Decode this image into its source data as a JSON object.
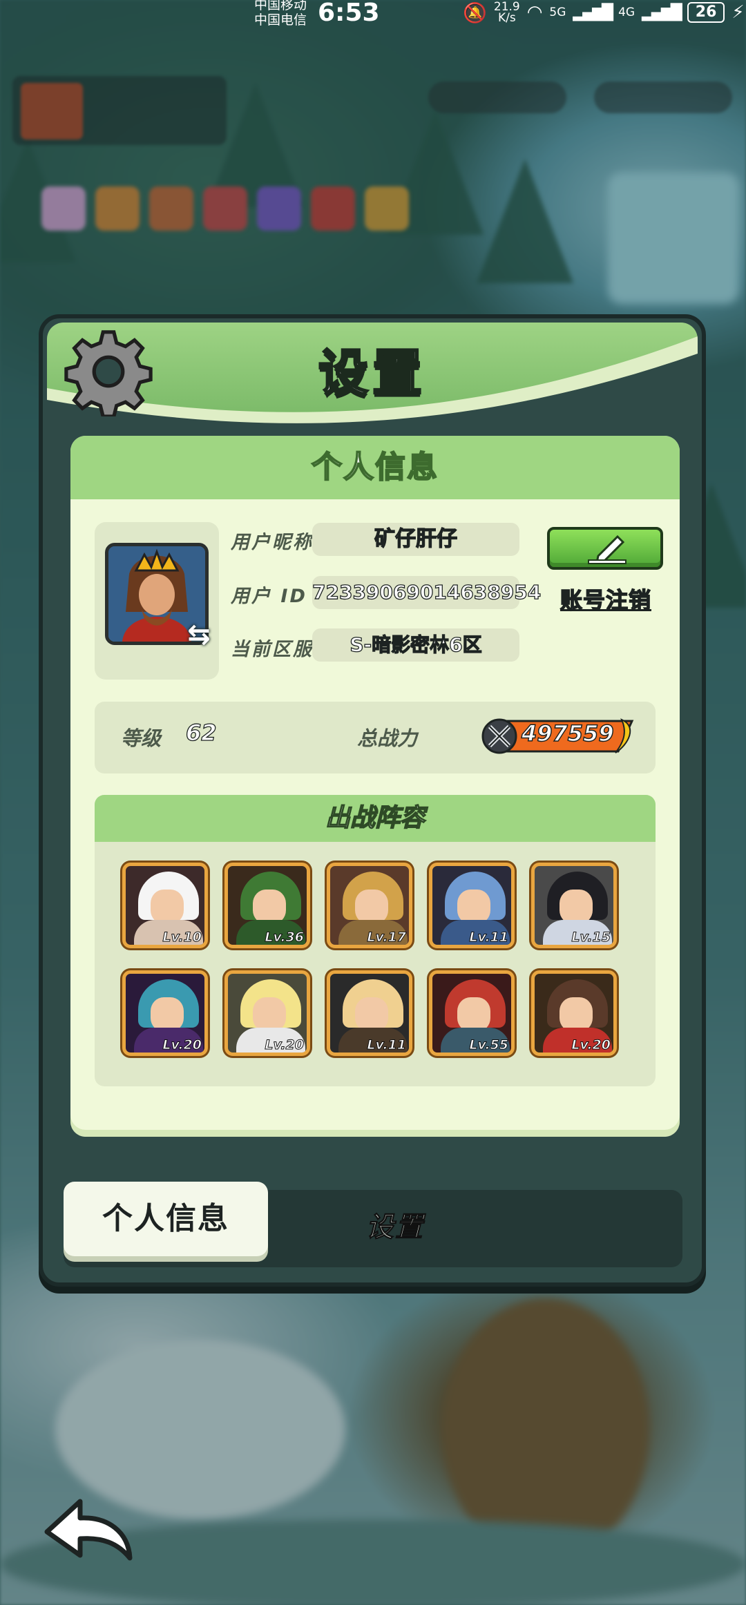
{
  "status_bar": {
    "carrier_1": "中国移动",
    "carrier_2": "中国电信",
    "time": "6:53",
    "speed": "21.9\nK/s",
    "speed_value": "21.9",
    "speed_unit": "K/s",
    "net_1": "5G",
    "net_2": "4G",
    "battery": "26"
  },
  "panel": {
    "title": "设置"
  },
  "personal_info": {
    "header": "个人信息",
    "nickname_label": "用户昵称",
    "nickname": "矿仔肝仔",
    "userid_label": "用户  ID",
    "user_id": "72339069014638954",
    "server_label": "当前区服",
    "server": "S-暗影密林6区",
    "account_cancel": "账号注销",
    "level_label": "等级",
    "level": "62",
    "power_label": "总战力",
    "power": "497559"
  },
  "lineup": {
    "header": "出战阵容",
    "heroes": [
      {
        "level": "Lv.10",
        "color": "#f2d0b8",
        "hair": "#f5f5f5",
        "body": "#d8c2b0",
        "bg": "#3d2a2a"
      },
      {
        "level": "Lv.36",
        "color": "#4a7a3a",
        "hair": "#3f7a34",
        "body": "#2d5a2a",
        "bg": "#3a2a1c"
      },
      {
        "level": "Lv.17",
        "color": "#c99a5a",
        "hair": "#d2a24a",
        "body": "#8a6a3a",
        "bg": "#5a3a2a"
      },
      {
        "level": "Lv.11",
        "color": "#8ab0d8",
        "hair": "#6f9ad1",
        "body": "#3a5a8a",
        "bg": "#2a2a3a"
      },
      {
        "level": "Lv.15",
        "color": "#2a2a2a",
        "hair": "#1f1f24",
        "body": "#cfd6e2",
        "bg": "#4a4a4a"
      },
      {
        "level": "Lv.20",
        "color": "#6a3a8a",
        "hair": "#3a9ab0",
        "body": "#4a2a6a",
        "bg": "#2a1a3a"
      },
      {
        "level": "Lv.20",
        "color": "#f5f0e0",
        "hair": "#f3e38a",
        "body": "#e8e8e8",
        "bg": "#4a4a3a"
      },
      {
        "level": "Lv.11",
        "color": "#e8c07a",
        "hair": "#f0d090",
        "body": "#4a3a2a",
        "bg": "#2a2a2a"
      },
      {
        "level": "Lv.55",
        "color": "#b83a2a",
        "hair": "#c03a2e",
        "body": "#3a5a6a",
        "bg": "#3a1a1a"
      },
      {
        "level": "Lv.20",
        "color": "#b83a2a",
        "hair": "#5a3a2a",
        "body": "#c0302a",
        "bg": "#3a2a1a"
      }
    ]
  },
  "tabs": {
    "personal": "个人信息",
    "settings": "设置"
  },
  "colors": {
    "panel_green": "#9fd682",
    "card_bg": "#f0f9d9",
    "hero_frame": "#e9a640",
    "edit_btn": "#5bb63e"
  },
  "icons": {
    "gear": "gear-icon",
    "edit": "pencil-icon",
    "swap": "swap-icon",
    "back": "back-arrow-icon",
    "power": "crossed-swords-icon"
  }
}
